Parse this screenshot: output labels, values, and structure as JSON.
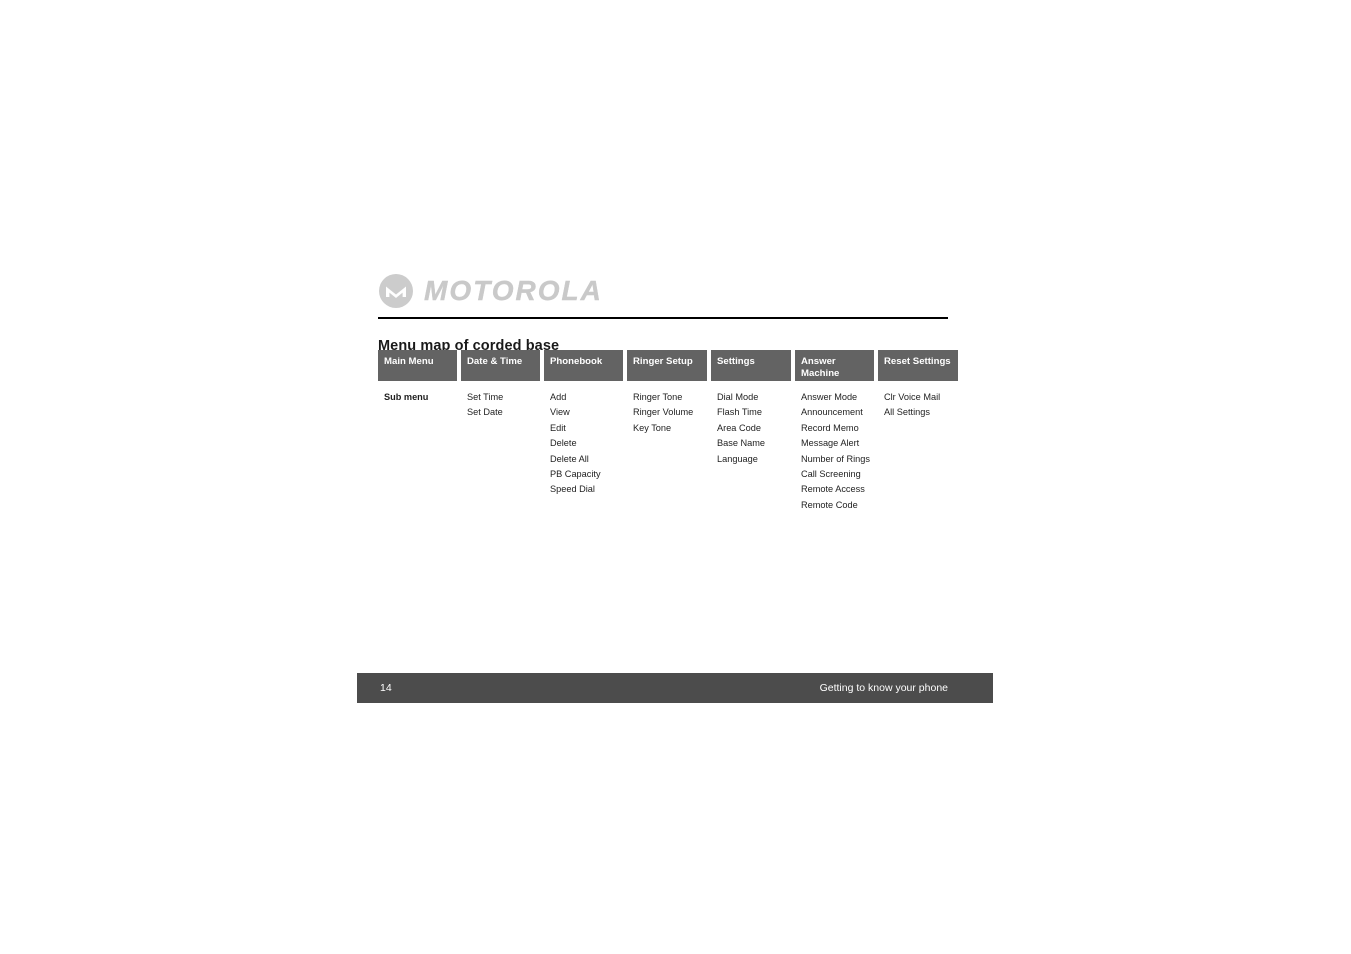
{
  "document": {
    "brand": {
      "wordmark": "MOTOROLA",
      "logo_icon": "motorola-batwing-icon",
      "logo_color": "#c9c9c9"
    },
    "section_title": "Menu map of corded base"
  },
  "menu_map": {
    "row_label": "Sub menu",
    "header_bg": "#636363",
    "header_text_color": "#ffffff",
    "columns": [
      {
        "header": "Main Menu",
        "items": []
      },
      {
        "header": "Date & Time",
        "items": [
          "Set Time",
          "Set Date"
        ]
      },
      {
        "header": "Phonebook",
        "items": [
          "Add",
          "View",
          "Edit",
          "Delete",
          "Delete All",
          "PB Capacity",
          "Speed Dial"
        ]
      },
      {
        "header": "Ringer Setup",
        "items": [
          "Ringer Tone",
          "Ringer Volume",
          "Key Tone"
        ]
      },
      {
        "header": "Settings",
        "items": [
          "Dial Mode",
          "Flash Time",
          "Area Code",
          "Base Name",
          "Language"
        ]
      },
      {
        "header": "Answer\nMachine",
        "items": [
          "Answer Mode",
          "Announcement",
          "Record Memo",
          "Message Alert",
          "Number of Rings",
          "Call Screening",
          "Remote Access",
          "Remote Code"
        ]
      },
      {
        "header": "Reset Settings",
        "items": [
          "Clr Voice Mail",
          "All Settings"
        ]
      }
    ]
  },
  "footer": {
    "page_number": "14",
    "section_label": "Getting to know your phone",
    "bg": "#4c4c4c"
  }
}
